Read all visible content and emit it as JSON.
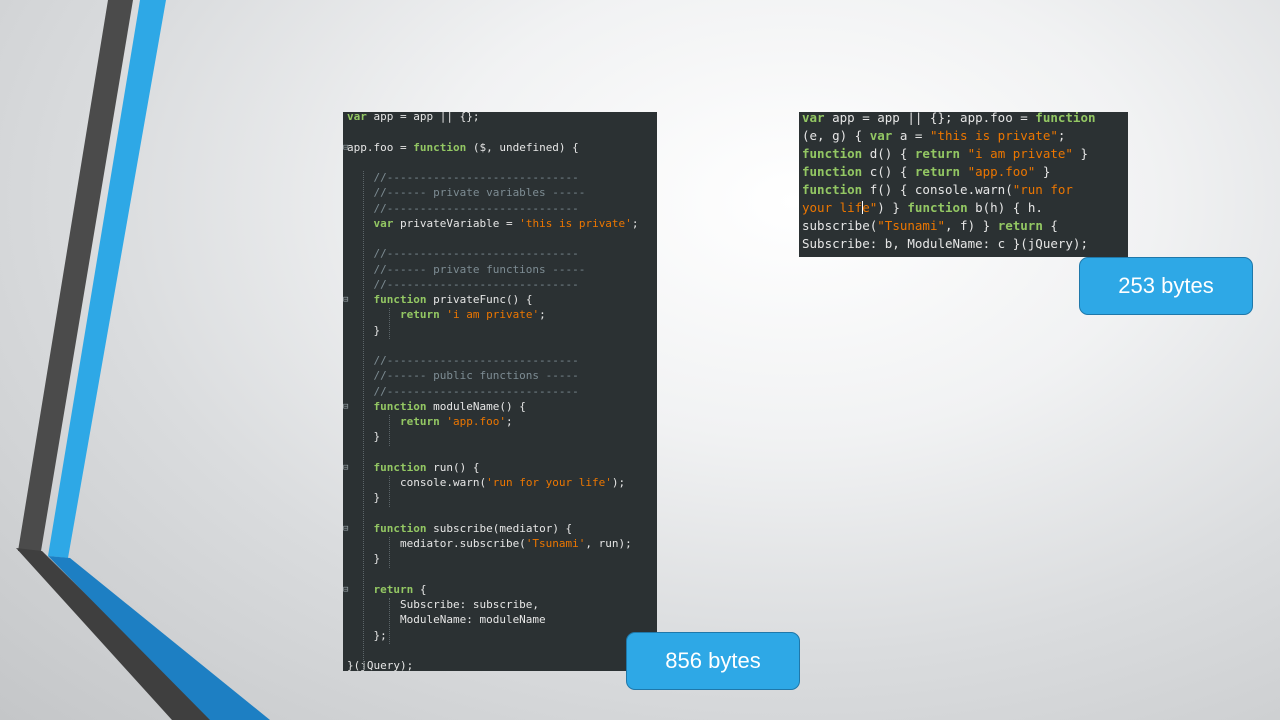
{
  "slide": {
    "colors": {
      "accent_blue": "#2ea8e6",
      "dark_stripe": "#4a4a4a",
      "code_bg": "#2b3133",
      "keyword": "#93c763",
      "string": "#ec7600",
      "comment": "#7d8c93"
    }
  },
  "original_code": {
    "lines": [
      [
        [
          "kw",
          "var"
        ],
        [
          "t",
          " app = app || {};"
        ]
      ],
      [],
      [
        [
          "t",
          "app.foo = "
        ],
        [
          "kw",
          "function"
        ],
        [
          "t",
          " ($, undefined) {"
        ]
      ],
      [],
      [
        [
          "cm",
          "    //-----------------------------"
        ]
      ],
      [
        [
          "cm",
          "    //------ private variables -----"
        ]
      ],
      [
        [
          "cm",
          "    //-----------------------------"
        ]
      ],
      [
        [
          "t",
          "    "
        ],
        [
          "kw",
          "var"
        ],
        [
          "t",
          " privateVariable = "
        ],
        [
          "str",
          "'this is private'"
        ],
        [
          "t",
          ";"
        ]
      ],
      [],
      [
        [
          "cm",
          "    //-----------------------------"
        ]
      ],
      [
        [
          "cm",
          "    //------ private functions -----"
        ]
      ],
      [
        [
          "cm",
          "    //-----------------------------"
        ]
      ],
      [
        [
          "t",
          "    "
        ],
        [
          "kw",
          "function"
        ],
        [
          "t",
          " privateFunc() {"
        ]
      ],
      [
        [
          "t",
          "        "
        ],
        [
          "kw",
          "return"
        ],
        [
          "t",
          " "
        ],
        [
          "str",
          "'i am private'"
        ],
        [
          "t",
          ";"
        ]
      ],
      [
        [
          "t",
          "    }"
        ]
      ],
      [],
      [
        [
          "cm",
          "    //-----------------------------"
        ]
      ],
      [
        [
          "cm",
          "    //------ public functions -----"
        ]
      ],
      [
        [
          "cm",
          "    //-----------------------------"
        ]
      ],
      [
        [
          "t",
          "    "
        ],
        [
          "kw",
          "function"
        ],
        [
          "t",
          " moduleName() {"
        ]
      ],
      [
        [
          "t",
          "        "
        ],
        [
          "kw",
          "return"
        ],
        [
          "t",
          " "
        ],
        [
          "str",
          "'app.foo'"
        ],
        [
          "t",
          ";"
        ]
      ],
      [
        [
          "t",
          "    }"
        ]
      ],
      [],
      [
        [
          "t",
          "    "
        ],
        [
          "kw",
          "function"
        ],
        [
          "t",
          " run() {"
        ]
      ],
      [
        [
          "t",
          "        console.warn("
        ],
        [
          "str",
          "'run for your life'"
        ],
        [
          "t",
          ");"
        ]
      ],
      [
        [
          "t",
          "    }"
        ]
      ],
      [],
      [
        [
          "t",
          "    "
        ],
        [
          "kw",
          "function"
        ],
        [
          "t",
          " subscribe(mediator) {"
        ]
      ],
      [
        [
          "t",
          "        mediator.subscribe("
        ],
        [
          "str",
          "'Tsunami'"
        ],
        [
          "t",
          ", run);"
        ]
      ],
      [
        [
          "t",
          "    }"
        ]
      ],
      [],
      [
        [
          "t",
          "    "
        ],
        [
          "kw",
          "return"
        ],
        [
          "t",
          " {"
        ]
      ],
      [
        [
          "t",
          "        Subscribe: subscribe,"
        ]
      ],
      [
        [
          "t",
          "        ModuleName: moduleName"
        ]
      ],
      [
        [
          "t",
          "    };"
        ]
      ],
      [],
      [
        [
          "t",
          "}(jQuery);"
        ]
      ]
    ]
  },
  "minified_code": {
    "lines": [
      [
        [
          "kw",
          "var"
        ],
        [
          "t",
          " app = app || {}; app.foo = "
        ],
        [
          "kw",
          "function"
        ]
      ],
      [
        [
          "t",
          "(e, g) { "
        ],
        [
          "kw",
          "var"
        ],
        [
          "t",
          " a = "
        ],
        [
          "str",
          "\"this is private\""
        ],
        [
          "t",
          ";"
        ]
      ],
      [
        [
          "kw",
          "function"
        ],
        [
          "t",
          " d() { "
        ],
        [
          "kw",
          "return"
        ],
        [
          "t",
          " "
        ],
        [
          "str",
          "\"i am private\""
        ],
        [
          "t",
          " }"
        ]
      ],
      [
        [
          "kw",
          "function"
        ],
        [
          "t",
          " c() { "
        ],
        [
          "kw",
          "return"
        ],
        [
          "t",
          " "
        ],
        [
          "str",
          "\"app.foo\""
        ],
        [
          "t",
          " }"
        ]
      ],
      [
        [
          "kw",
          "function"
        ],
        [
          "t",
          " f() { console.warn("
        ],
        [
          "str",
          "\"run for"
        ]
      ],
      [
        [
          "str",
          "your life\""
        ],
        [
          "t",
          ") } "
        ],
        [
          "kw",
          "function"
        ],
        [
          "t",
          " b(h) { h."
        ]
      ],
      [
        [
          "t",
          "subscribe("
        ],
        [
          "str",
          "\"Tsunami\""
        ],
        [
          "t",
          ", f) } "
        ],
        [
          "kw",
          "return"
        ],
        [
          "t",
          " {"
        ]
      ],
      [
        [
          "t",
          "Subscribe: b, ModuleName: c }(jQuery);"
        ]
      ]
    ]
  },
  "badges": {
    "minified_size": "253 bytes",
    "original_size": "856 bytes"
  }
}
